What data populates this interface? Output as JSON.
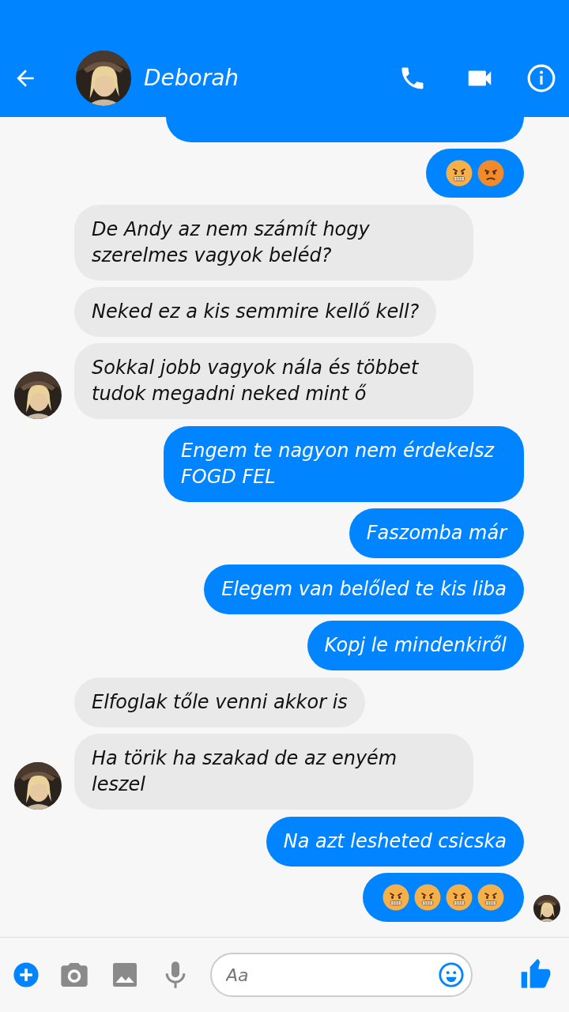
{
  "header": {
    "contact_name": "Deborah"
  },
  "messages": [
    {
      "kind": "outgoing",
      "cut": true
    },
    {
      "kind": "outgoing",
      "emojis": [
        {
          "kind": "grimacing"
        },
        {
          "kind": "angry"
        }
      ]
    },
    {
      "kind": "incoming",
      "text": "De Andy az nem számít hogy szerelmes vagyok beléd?"
    },
    {
      "kind": "incoming",
      "text": "Neked ez a kis semmire kellő kell?"
    },
    {
      "kind": "incoming",
      "text": "Sokkal jobb vagyok nála és többet tudok megadni neked mint ő",
      "avatar": true
    },
    {
      "kind": "outgoing",
      "text": "Engem te nagyon nem érdekelsz FOGD FEL"
    },
    {
      "kind": "outgoing",
      "text": "Faszomba már"
    },
    {
      "kind": "outgoing",
      "text": "Elegem van belőled te kis liba"
    },
    {
      "kind": "outgoing",
      "text": "Kopj le mindenkiről"
    },
    {
      "kind": "incoming",
      "text": "Elfoglak tőle venni akkor is"
    },
    {
      "kind": "incoming",
      "text": "Ha törik ha szakad de az enyém leszel",
      "avatar": true
    },
    {
      "kind": "outgoing",
      "text": "Na azt lesheted csicska"
    },
    {
      "kind": "outgoing",
      "emojis": [
        {
          "kind": "grimacing"
        },
        {
          "kind": "grimacing"
        },
        {
          "kind": "grimacing"
        },
        {
          "kind": "grimacing"
        }
      ],
      "seen": true
    }
  ],
  "composer": {
    "placeholder": "Aa"
  }
}
